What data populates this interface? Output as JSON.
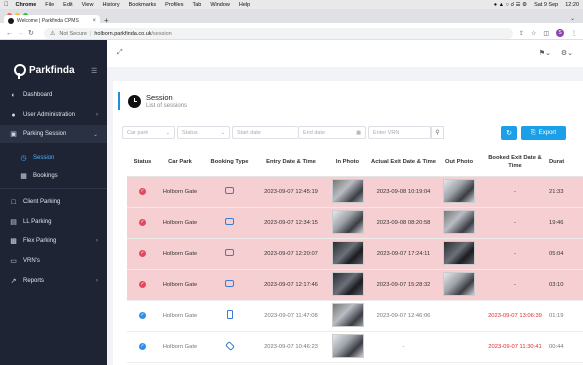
{
  "menubar": {
    "apple": "",
    "items": [
      "Chrome",
      "File",
      "Edit",
      "View",
      "History",
      "Bookmarks",
      "Profiles",
      "Tab",
      "Window",
      "Help"
    ],
    "datetime": "Sat 9 Sep",
    "time": "12:20"
  },
  "browser": {
    "tab_title": "Welcome | Parkfinda CPMS",
    "security": "Not Secure",
    "url_host": "holborn.parkfinda.co.uk",
    "url_path": "/session",
    "profile_initial": "S"
  },
  "sidebar": {
    "brand": "Parkfinda",
    "items": [
      {
        "label": "Dashboard",
        "icon": "dashboard-icon"
      },
      {
        "label": "User Administration",
        "icon": "user-icon"
      },
      {
        "label": "Parking Session",
        "icon": "briefcase-icon"
      },
      {
        "label": "Session",
        "icon": "clock-icon"
      },
      {
        "label": "Bookings",
        "icon": "calendar-icon"
      },
      {
        "label": "Client Parking",
        "icon": "client-icon"
      },
      {
        "label": "LL Parking",
        "icon": "parking-icon"
      },
      {
        "label": "Flex Parking",
        "icon": "car-icon"
      },
      {
        "label": "VRN's",
        "icon": "vrn-icon"
      },
      {
        "label": "Reports",
        "icon": "chart-icon"
      }
    ]
  },
  "page": {
    "title": "Session",
    "subtitle": "List of sessions"
  },
  "filters": {
    "car_park": "Car park",
    "status": "Status",
    "start_date": "Start date",
    "end_date": "End date",
    "vrn_placeholder": "Enter VRN",
    "export_label": "Export"
  },
  "table": {
    "headers": [
      "Status",
      "Car Park",
      "Booking Type",
      "Entry Date & Time",
      "In Photo",
      "Actual Exit Date & Time",
      "Out Photo",
      "Booked Exit Date & Time",
      "Durat"
    ],
    "rows": [
      {
        "car_park": "Holborn Gate",
        "entry": "2023-09-07 12:45:19",
        "exit": "2023-09-08 10:19:04",
        "booked_exit": "-",
        "duration": "21:33"
      },
      {
        "car_park": "Holborn Gate",
        "entry": "2023-09-07 12:34:15",
        "exit": "2023-09-08 08:20:58",
        "booked_exit": "-",
        "duration": "19:46"
      },
      {
        "car_park": "Holborn Gate",
        "entry": "2023-09-07 12:20:07",
        "exit": "2023-09-07 17:24:11",
        "booked_exit": "-",
        "duration": "05:04"
      },
      {
        "car_park": "Holborn Gate",
        "entry": "2023-09-07 12:17:46",
        "exit": "2023-09-07 15:28:32",
        "booked_exit": "-",
        "duration": "03:10"
      },
      {
        "car_park": "Holborn Gate",
        "entry": "2023-09-07 11:47:08",
        "exit": "2023-09-07 12:46:06",
        "booked_exit": "2023-09-07 13:06:39",
        "duration": "01:19"
      },
      {
        "car_park": "Holborn Gate",
        "entry": "2023-09-07 10:46:23",
        "exit": "-",
        "booked_exit": "2023-09-07 11:30:41",
        "duration": "00:44"
      }
    ]
  }
}
